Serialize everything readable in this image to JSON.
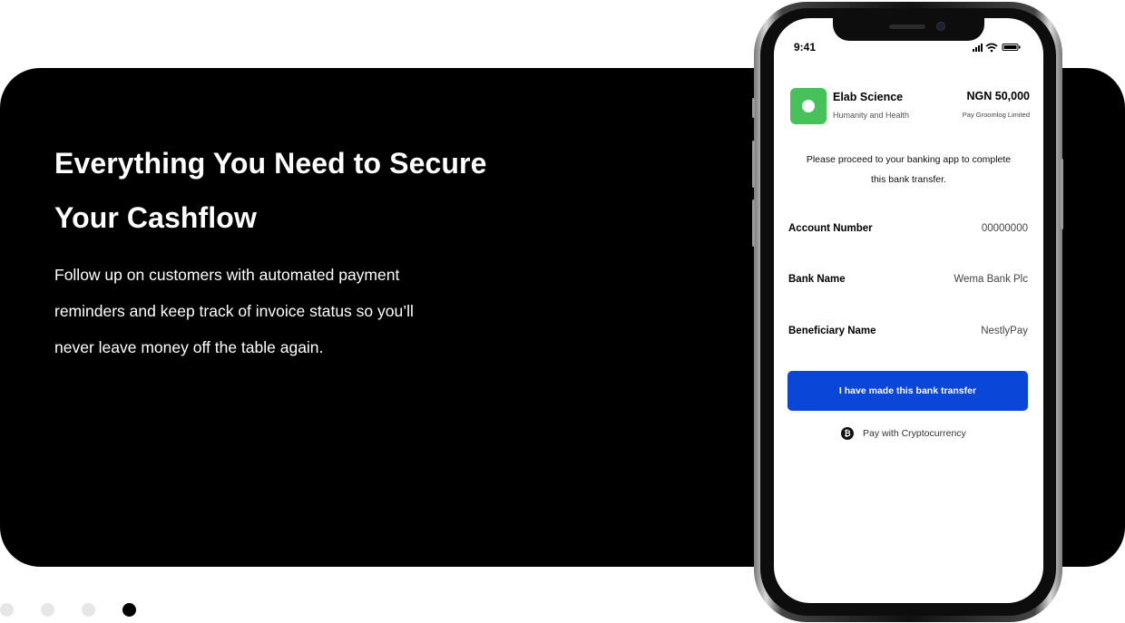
{
  "hero": {
    "headline": "Everything You Need to Secure Your Cashflow",
    "body": "Follow up on customers with automated payment reminders and keep track of invoice status so you’ll never leave money off the table again."
  },
  "carousel": {
    "slide_count": 4,
    "active_index": 3
  },
  "phone": {
    "status_bar": {
      "time": "9:41",
      "icons": [
        "cellular-signal-icon",
        "wifi-icon",
        "battery-icon"
      ]
    },
    "merchant": {
      "name": "Elab Science",
      "tagline": "Humanity and Health",
      "logo_color": "#47c15a"
    },
    "amount": "NGN 50,000",
    "payee": "Pay Groomlog Limited",
    "instruction": "Please proceed to your banking app to complete this bank transfer.",
    "details": [
      {
        "label": "Account Number",
        "value": "00000000"
      },
      {
        "label": "Bank Name",
        "value": "Wema Bank Plc"
      },
      {
        "label": "Beneficiary Name",
        "value": "NestlyPay"
      }
    ],
    "primary_button": "I have made this bank transfer",
    "alt_payment": "Pay with Cryptocurrency",
    "alt_payment_icon": "bitcoin-icon",
    "colors": {
      "primary": "#0a46d8",
      "hero_background": "#000000"
    }
  }
}
